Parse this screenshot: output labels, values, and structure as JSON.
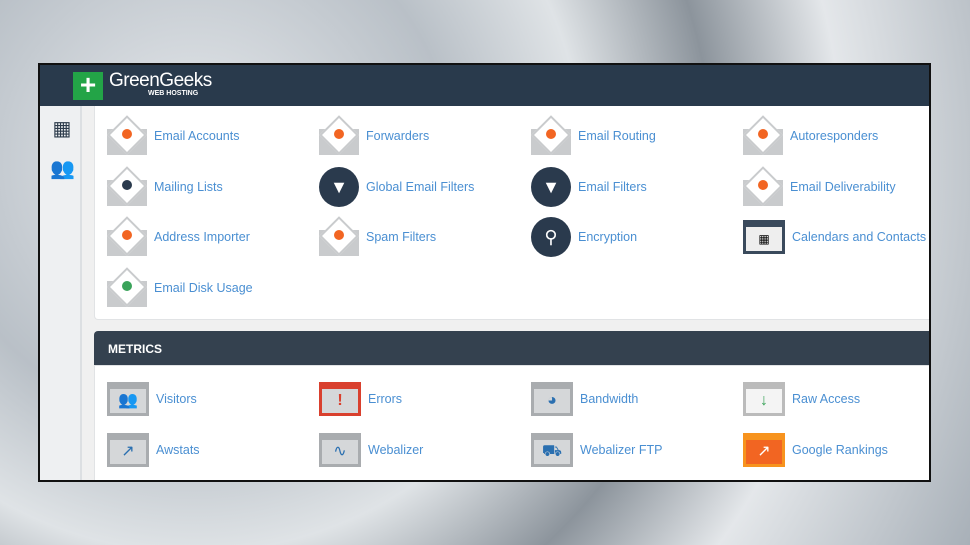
{
  "brand": {
    "name": "GreenGeeks",
    "tagline": "WEB HOSTING",
    "plus": "+"
  },
  "sidebar": [
    {
      "icon": "grid-icon"
    },
    {
      "icon": "users-icon"
    }
  ],
  "email": {
    "items": [
      {
        "label": "Email Accounts",
        "icon": "envelope-user-icon"
      },
      {
        "label": "Forwarders",
        "icon": "envelope-arrow-icon"
      },
      {
        "label": "Email Routing",
        "icon": "envelope-routing-icon"
      },
      {
        "label": "Autoresponders",
        "icon": "envelope-auto-icon"
      },
      {
        "label": "Mailing Lists",
        "icon": "envelope-list-icon"
      },
      {
        "label": "Global Email Filters",
        "icon": "global-filter-icon"
      },
      {
        "label": "Email Filters",
        "icon": "filter-icon"
      },
      {
        "label": "Email Deliverability",
        "icon": "envelope-key-icon"
      },
      {
        "label": "Address Importer",
        "icon": "envelope-import-icon"
      },
      {
        "label": "Spam Filters",
        "icon": "envelope-spam-icon"
      },
      {
        "label": "Encryption",
        "icon": "key-icon"
      },
      {
        "label": "Calendars and Contacts",
        "icon": "calendar-icon"
      },
      {
        "label": "Email Disk Usage",
        "icon": "envelope-pie-icon"
      }
    ]
  },
  "metrics": {
    "title": "METRICS",
    "items": [
      {
        "label": "Visitors",
        "icon": "visitors-icon"
      },
      {
        "label": "Errors",
        "icon": "errors-icon"
      },
      {
        "label": "Bandwidth",
        "icon": "bandwidth-icon"
      },
      {
        "label": "Raw Access",
        "icon": "raw-access-icon"
      },
      {
        "label": "Awstats",
        "icon": "awstats-icon"
      },
      {
        "label": "Webalizer",
        "icon": "webalizer-icon"
      },
      {
        "label": "Webalizer FTP",
        "icon": "webalizer-ftp-icon"
      },
      {
        "label": "Google Rankings",
        "icon": "google-rankings-icon"
      }
    ]
  },
  "colors": {
    "header": "#293a4c",
    "link": "#4a8fd2",
    "brand": "#23a447",
    "accent": "#f26522"
  }
}
